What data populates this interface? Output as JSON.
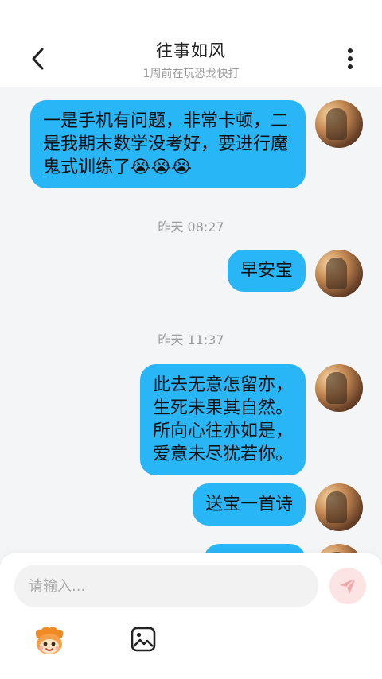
{
  "header": {
    "title": "往事如风",
    "subtitle": "1周前在玩恐龙快打"
  },
  "icons": {
    "back": "back-chevron-icon",
    "more": "more-vertical-icon",
    "send": "send-paper-plane-icon",
    "emoji": "mascot-emoji-icon",
    "image": "image-icon"
  },
  "colors": {
    "bubble": "#29b6f6",
    "send_button_bg": "#fde4e4",
    "send_icon": "#f4a9a9"
  },
  "messages": [
    {
      "text": "一是手机有问题，非常卡顿，二是我期末数学没考好，要进行魔鬼式训练了😭😭😭"
    },
    {
      "text": "早安宝"
    },
    {
      "text": "此去无意怎留亦，\n生死未果其自然。\n所向心往亦如是，\n爱意未尽犹若你。"
    },
    {
      "text": "送宝一首诗"
    }
  ],
  "timestamps": [
    "昨天 08:27",
    "昨天 11:37"
  ],
  "composer": {
    "placeholder": "请输入..."
  }
}
